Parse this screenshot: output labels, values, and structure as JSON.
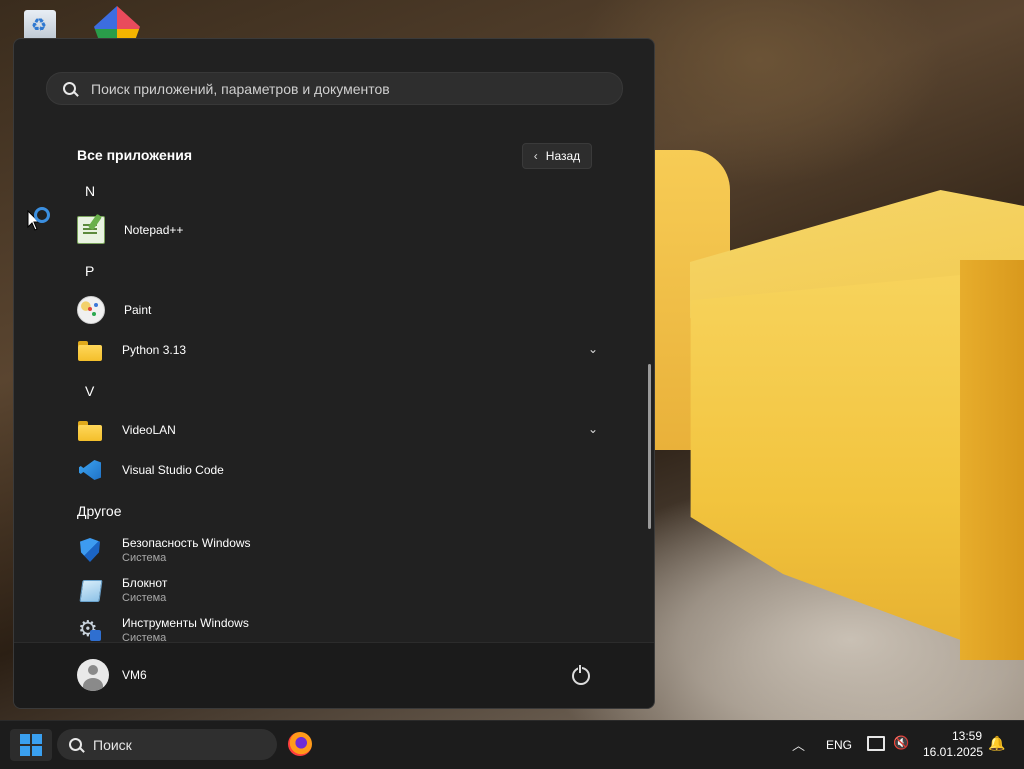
{
  "start_menu": {
    "search_placeholder": "Поиск приложений, параметров и документов",
    "all_apps_title": "Все приложения",
    "back_button": "Назад",
    "groups": [
      {
        "letter": "N",
        "apps": [
          {
            "name": "Notepad++",
            "icon": "notepadpp-icon"
          }
        ]
      },
      {
        "letter": "P",
        "apps": [
          {
            "name": "Paint",
            "icon": "paint-icon"
          },
          {
            "name": "Python 3.13",
            "icon": "folder-icon",
            "expandable": true
          }
        ]
      },
      {
        "letter": "V",
        "apps": [
          {
            "name": "VideoLAN",
            "icon": "folder-icon",
            "expandable": true
          },
          {
            "name": "Visual Studio Code",
            "icon": "vscode-icon"
          }
        ]
      }
    ],
    "other_section_title": "Другое",
    "other_apps": [
      {
        "name": "Безопасность Windows",
        "subtitle": "Система",
        "icon": "windows-security-icon"
      },
      {
        "name": "Блокнот",
        "subtitle": "Система",
        "icon": "notepad-icon"
      },
      {
        "name": "Инструменты Windows",
        "subtitle": "Система",
        "icon": "windows-tools-icon"
      }
    ],
    "user_name": "VM6"
  },
  "taskbar": {
    "search_label": "Поиск",
    "language": "ENG",
    "time": "13:59",
    "date": "16.01.2025"
  },
  "colors": {
    "menu_background": "#212121",
    "accent": "#3aa0f0"
  }
}
